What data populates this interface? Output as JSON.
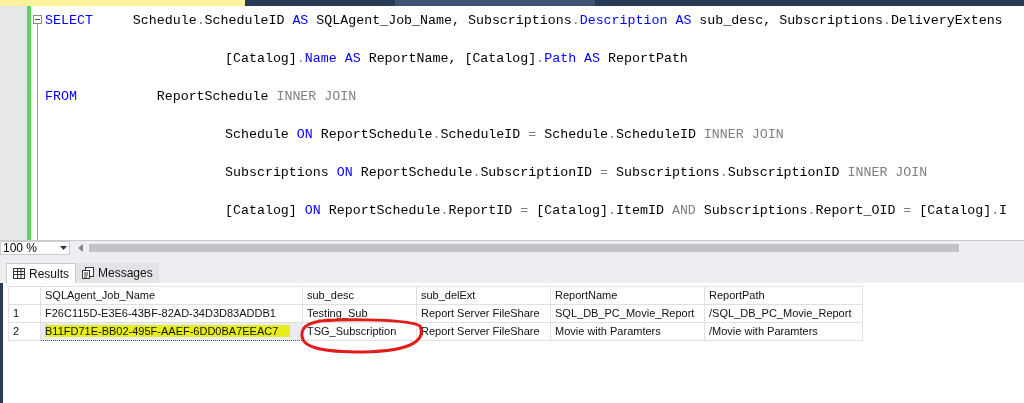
{
  "document_tabs": [
    {
      "selected": true
    },
    {
      "selected": false
    }
  ],
  "editor": {
    "lines": [
      {
        "kind": "statement",
        "tokens": [
          {
            "kind": "keyword",
            "text": "SELECT"
          },
          {
            "kind": "plain",
            "text": "     Schedule"
          },
          {
            "kind": "gray",
            "text": "."
          },
          {
            "kind": "plain",
            "text": "ScheduleID "
          },
          {
            "kind": "keyword",
            "text": "AS"
          },
          {
            "kind": "plain",
            "text": " SQLAgent_Job_Name, Subscriptions"
          },
          {
            "kind": "gray",
            "text": "."
          },
          {
            "kind": "keyword",
            "text": "Description AS"
          },
          {
            "kind": "plain",
            "text": " sub_desc, Subscriptions"
          },
          {
            "kind": "gray",
            "text": "."
          },
          {
            "kind": "plain",
            "text": "DeliveryExtens"
          }
        ]
      },
      {
        "kind": "continuation",
        "tokens": [
          {
            "kind": "plain",
            "text": "[Catalog]"
          },
          {
            "kind": "gray",
            "text": "."
          },
          {
            "kind": "keyword",
            "text": "Name AS"
          },
          {
            "kind": "plain",
            "text": " ReportName, [Catalog]"
          },
          {
            "kind": "gray",
            "text": "."
          },
          {
            "kind": "keyword",
            "text": "Path AS"
          },
          {
            "kind": "plain",
            "text": " ReportPath"
          }
        ]
      },
      {
        "kind": "statement",
        "tokens": [
          {
            "kind": "keyword",
            "text": "FROM"
          },
          {
            "kind": "plain",
            "text": "          ReportSchedule "
          },
          {
            "kind": "gray",
            "text": "INNER JOIN"
          }
        ]
      },
      {
        "kind": "continuation",
        "tokens": [
          {
            "kind": "plain",
            "text": "Schedule "
          },
          {
            "kind": "keyword",
            "text": "ON"
          },
          {
            "kind": "plain",
            "text": " ReportSchedule"
          },
          {
            "kind": "gray",
            "text": "."
          },
          {
            "kind": "plain",
            "text": "ScheduleID "
          },
          {
            "kind": "gray",
            "text": "="
          },
          {
            "kind": "plain",
            "text": " Schedule"
          },
          {
            "kind": "gray",
            "text": "."
          },
          {
            "kind": "plain",
            "text": "ScheduleID "
          },
          {
            "kind": "gray",
            "text": "INNER JOIN"
          }
        ]
      },
      {
        "kind": "continuation",
        "tokens": [
          {
            "kind": "plain",
            "text": "Subscriptions "
          },
          {
            "kind": "keyword",
            "text": "ON"
          },
          {
            "kind": "plain",
            "text": " ReportSchedule"
          },
          {
            "kind": "gray",
            "text": "."
          },
          {
            "kind": "plain",
            "text": "SubscriptionID "
          },
          {
            "kind": "gray",
            "text": "="
          },
          {
            "kind": "plain",
            "text": " Subscriptions"
          },
          {
            "kind": "gray",
            "text": "."
          },
          {
            "kind": "plain",
            "text": "SubscriptionID "
          },
          {
            "kind": "gray",
            "text": "INNER JOIN"
          }
        ]
      },
      {
        "kind": "continuation",
        "tokens": [
          {
            "kind": "plain",
            "text": "[Catalog] "
          },
          {
            "kind": "keyword",
            "text": "ON"
          },
          {
            "kind": "plain",
            "text": " ReportSchedule"
          },
          {
            "kind": "gray",
            "text": "."
          },
          {
            "kind": "plain",
            "text": "ReportID "
          },
          {
            "kind": "gray",
            "text": "="
          },
          {
            "kind": "plain",
            "text": " [Catalog]"
          },
          {
            "kind": "gray",
            "text": "."
          },
          {
            "kind": "plain",
            "text": "ItemID "
          },
          {
            "kind": "gray",
            "text": "AND"
          },
          {
            "kind": "plain",
            "text": " Subscriptions"
          },
          {
            "kind": "gray",
            "text": "."
          },
          {
            "kind": "plain",
            "text": "Report_OID "
          },
          {
            "kind": "gray",
            "text": "="
          },
          {
            "kind": "plain",
            "text": " [Catalog]"
          },
          {
            "kind": "gray",
            "text": "."
          },
          {
            "kind": "plain",
            "text": "I"
          }
        ]
      }
    ],
    "zoom": "100 %"
  },
  "result_tabs": [
    {
      "label": "Results",
      "kind": "grid",
      "selected": true
    },
    {
      "label": "Messages",
      "kind": "messages",
      "selected": false
    }
  ],
  "table": {
    "columns": [
      "SQLAgent_Job_Name",
      "sub_desc",
      "sub_delExt",
      "ReportName",
      "ReportPath"
    ],
    "rows": [
      {
        "number": "1",
        "cells": [
          {
            "text": "F26C115D-E3E6-43BF-82AD-34D3D83ADDB1",
            "highlighted": false,
            "selected": false
          },
          {
            "text": "Testing_Sub",
            "highlighted": false,
            "selected": false
          },
          {
            "text": "Report Server FileShare",
            "highlighted": false,
            "selected": false
          },
          {
            "text": "SQL_DB_PC_Movie_Report",
            "highlighted": false,
            "selected": false
          },
          {
            "text": "/SQL_DB_PC_Movie_Report",
            "highlighted": false,
            "selected": false
          }
        ]
      },
      {
        "number": "2",
        "cells": [
          {
            "text": "B11FD71E-BB02-495F-AAEF-6DD0BA7EEAC7",
            "highlighted": true,
            "selected": true
          },
          {
            "text": "TSG_Subscription",
            "highlighted": false,
            "selected": false
          },
          {
            "text": "Report Server FileShare",
            "highlighted": false,
            "selected": false
          },
          {
            "text": "Movie with Paramters",
            "highlighted": false,
            "selected": false
          },
          {
            "text": "/Movie with Paramters",
            "highlighted": false,
            "selected": false
          }
        ]
      }
    ]
  }
}
